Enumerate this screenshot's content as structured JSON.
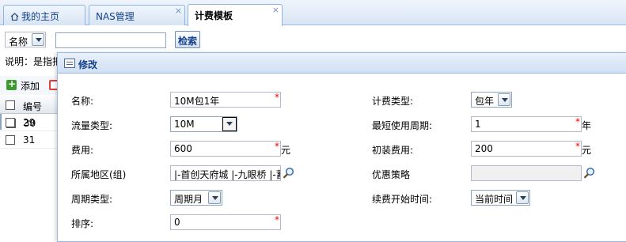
{
  "tabs": [
    {
      "label": "我的主页",
      "icon": "home-icon"
    },
    {
      "label": "NAS管理"
    },
    {
      "label": "计费模板",
      "active": true
    }
  ],
  "tab_close": "×",
  "search": {
    "field_label": "名称",
    "query": "",
    "button": "检索"
  },
  "note": "说明：是指把",
  "toolbar": {
    "add": "添加"
  },
  "grid": {
    "header": "编号",
    "rows": [
      "30",
      "29",
      "31"
    ]
  },
  "window": {
    "title": "修改",
    "left_fields": {
      "name_label": "名称:",
      "name_value": "10M包1年",
      "flow_type_label": "流量类型:",
      "flow_type_value": "10M",
      "fee_label": "费用:",
      "fee_value": "600",
      "fee_unit": "元",
      "region_label": "所属地区(组)",
      "region_value": "|-首创天府城 |-九眼桥 |-蓄",
      "period_type_label": "周期类型:",
      "period_type_value": "周期月",
      "order_label": "排序:",
      "order_value": "0"
    },
    "right_fields": {
      "billing_type_label": "计费类型:",
      "billing_type_value": "包年",
      "min_period_label": "最短使用周期:",
      "min_period_value": "1",
      "min_period_unit": "年",
      "install_fee_label": "初装费用:",
      "install_fee_value": "200",
      "install_fee_unit": "元",
      "discount_label": "优惠策略",
      "discount_value": "",
      "renew_label": "续费开始时间:",
      "renew_value": "当前时间"
    },
    "required_mark": "*"
  }
}
